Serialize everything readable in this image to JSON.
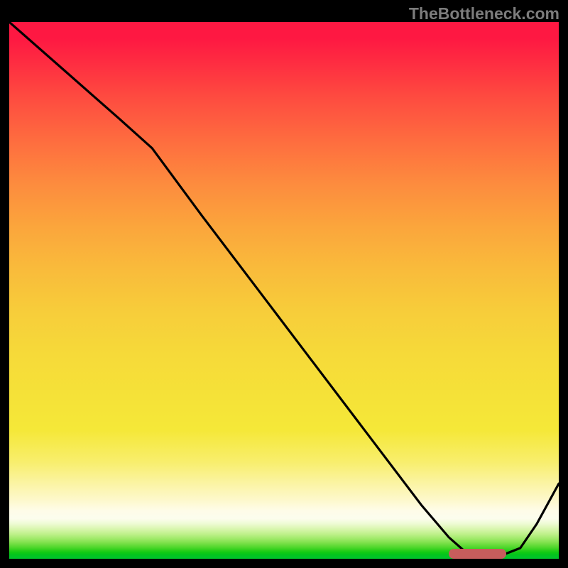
{
  "watermark": "TheBottleneck.com",
  "chart_data": {
    "type": "line",
    "title": "",
    "xlabel": "",
    "ylabel": "",
    "xlim": [
      0,
      100
    ],
    "ylim": [
      0,
      100
    ],
    "x": [
      0,
      10,
      20,
      26,
      35,
      45,
      55,
      65,
      75,
      80,
      83,
      86,
      89,
      93,
      96,
      100
    ],
    "values": [
      100,
      91,
      82,
      76.5,
      64,
      50.5,
      37,
      23.5,
      10,
      4,
      1.3,
      0.3,
      0.4,
      2,
      6.5,
      14
    ],
    "marker": {
      "x_start": 80,
      "x_end": 90.5,
      "y": 0.9
    },
    "gradient_stops": [
      {
        "pos": 0,
        "color": "#fe1842"
      },
      {
        "pos": 50,
        "color": "#f7d33a"
      },
      {
        "pos": 90,
        "color": "#fefce8"
      },
      {
        "pos": 100,
        "color": "#01c32e"
      }
    ]
  }
}
